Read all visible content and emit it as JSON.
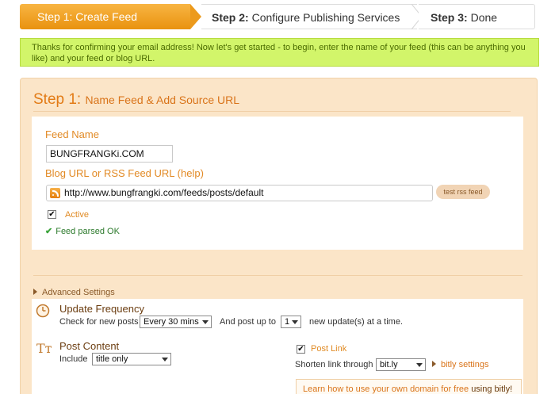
{
  "steps": [
    {
      "bold": "Step 1:",
      "label": "Create Feed"
    },
    {
      "bold": "Step 2:",
      "label": "Configure Publishing Services"
    },
    {
      "bold": "Step 3:",
      "label": "Done"
    }
  ],
  "notice": {
    "text": "Thanks for confirming your email address! Now let's get started - to begin, enter the name of your feed (this can be anything you like) and your feed or blog URL."
  },
  "panel": {
    "title_step": "Step 1:",
    "title_sub": "Name Feed & Add Source URL"
  },
  "feed_form": {
    "name_label": "Feed Name",
    "name_value": "BUNGFRANGKi.COM",
    "url_label": "Blog URL or RSS Feed URL (help)",
    "url_value": "http://www.bungfrangki.com/feeds/posts/default",
    "test_button": "test rss feed",
    "active_label": "Active",
    "active_checked": "✔",
    "parsed_text": "Feed parsed OK",
    "parsed_icon": "✔"
  },
  "advanced": {
    "label": "Advanced Settings"
  },
  "update_frequency": {
    "title": "Update Frequency",
    "check_label": "Check for new posts",
    "check_value": "Every 30 mins",
    "post_up_label": "And post up to",
    "post_up_value": "1",
    "tail_label": "new update(s) at a time."
  },
  "post_content": {
    "title": "Post Content",
    "icon_glyph": "Tт",
    "include_label": "Include",
    "include_value": "title only",
    "post_link_label": "Post Link",
    "post_link_checked": "✔",
    "shorten_label": "Shorten link through",
    "shorten_value": "bit.ly",
    "bitly_settings": "bitly settings",
    "learn_link": "Learn how to use your own domain for free",
    "learn_suffix": "using bitly!"
  },
  "colors": {
    "active_step": "#f0a02a",
    "notice_bg": "#d2f56a",
    "panel_bg": "#fbe5c8",
    "accent": "#e27b16"
  }
}
